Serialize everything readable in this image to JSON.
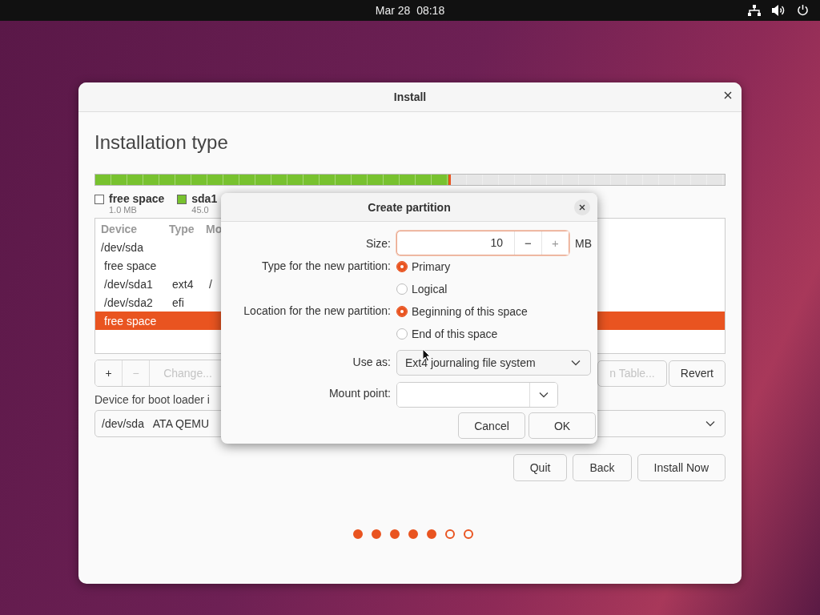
{
  "top_bar": {
    "clock": "Mar 28  08:18"
  },
  "window": {
    "title": "Install",
    "heading": "Installation type"
  },
  "partition_bar": [
    {
      "color": "#78c22f",
      "level": 0.561
    },
    {
      "color": "#e95420",
      "level": 0.004
    },
    {
      "color": "#e6e6e6",
      "level": 0.435
    }
  ],
  "legend": [
    {
      "label": "free space",
      "size": "1.0 MB",
      "color": "#ffffff"
    },
    {
      "label": "sda1",
      "size": "45.0",
      "color": "#78c22f"
    }
  ],
  "table": {
    "columns": [
      "Device",
      "Type",
      "Mo"
    ],
    "rows": [
      {
        "cells": [
          "/dev/sda",
          "",
          ""
        ],
        "selected": false,
        "children": [
          {
            "cells": [
              "free space",
              "",
              ""
            ],
            "selected": false
          },
          {
            "cells": [
              "/dev/sda1",
              "ext4",
              "/"
            ],
            "selected": false
          },
          {
            "cells": [
              "/dev/sda2",
              "efi",
              ""
            ],
            "selected": false
          },
          {
            "cells": [
              "free space",
              "",
              ""
            ],
            "selected": true
          }
        ]
      }
    ]
  },
  "partition_buttons": [
    {
      "label": "+",
      "disabled": false
    },
    {
      "label": "−",
      "disabled": true
    },
    {
      "label": "Change...",
      "disabled": true
    }
  ],
  "table_buttons": [
    {
      "label": "n Table...",
      "disabled": true
    },
    {
      "label": "Revert",
      "disabled": false
    }
  ],
  "boot_loader": {
    "label": "Device for boot loader i",
    "value": "/dev/sda   ATA QEMU"
  },
  "buttons": [
    "Quit",
    "Back",
    "Install Now"
  ],
  "steps": [
    {
      "done": true
    },
    {
      "done": true
    },
    {
      "done": true
    },
    {
      "done": true
    },
    {
      "done": true
    },
    {
      "done": false
    },
    {
      "done": false
    }
  ],
  "dialog": {
    "title": "Create partition",
    "size": {
      "label": "Size:",
      "value": "10",
      "minus": "−",
      "plus": "+",
      "plus_disabled": true,
      "unit": "MB"
    },
    "type": {
      "label": "Type for the new partition:",
      "options": [
        {
          "label": "Primary",
          "selected": true
        },
        {
          "label": "Logical",
          "selected": false
        }
      ]
    },
    "location": {
      "label": "Location for the new partition:",
      "options": [
        {
          "label": "Beginning of this space",
          "selected": true
        },
        {
          "label": "End of this space",
          "selected": false
        }
      ]
    },
    "use_as": {
      "label": "Use as:",
      "value": "Ext4 journaling file system"
    },
    "mount_point": {
      "label": "Mount point:"
    },
    "buttons": [
      "Cancel",
      "OK"
    ]
  }
}
